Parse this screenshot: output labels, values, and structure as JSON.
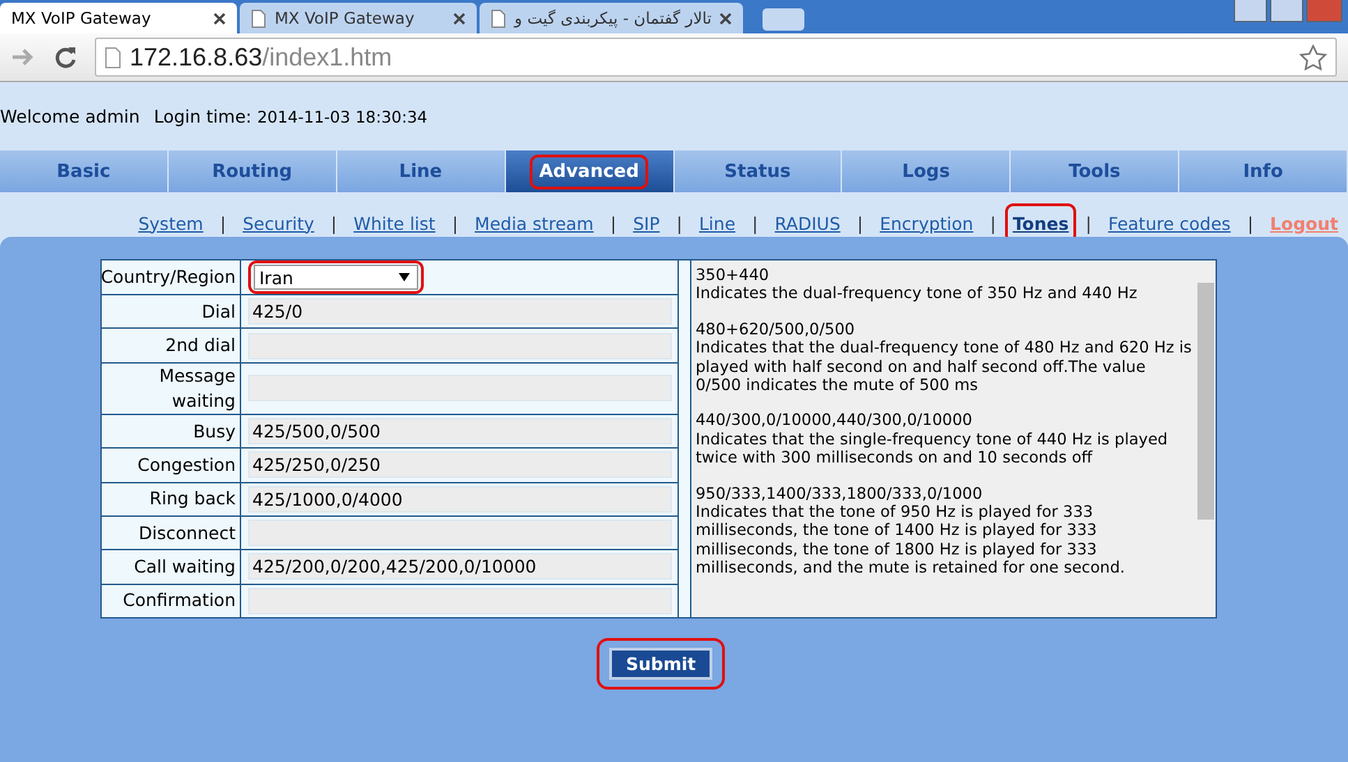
{
  "browser": {
    "tabs": [
      {
        "title": "MX VoIP Gateway",
        "selected": true
      },
      {
        "title": "MX VoIP Gateway",
        "selected": false
      },
      {
        "title": "تالار گفتمان - پیکربندی گیت و",
        "selected": false
      }
    ],
    "address": {
      "host": "172.16.8.63",
      "path": "/index1.htm"
    }
  },
  "header": {
    "welcome": "Welcome admin",
    "login_label": "Login time:",
    "login_time": "2014-11-03 18:30:34"
  },
  "main_tabs": [
    {
      "label": "Basic",
      "selected": false,
      "annotated": false
    },
    {
      "label": "Routing",
      "selected": false,
      "annotated": false
    },
    {
      "label": "Line",
      "selected": false,
      "annotated": false
    },
    {
      "label": "Advanced",
      "selected": true,
      "annotated": true
    },
    {
      "label": "Status",
      "selected": false,
      "annotated": false
    },
    {
      "label": "Logs",
      "selected": false,
      "annotated": false
    },
    {
      "label": "Tools",
      "selected": false,
      "annotated": false
    },
    {
      "label": "Info",
      "selected": false,
      "annotated": false
    }
  ],
  "sub_nav_separator": "|",
  "sub_nav": [
    {
      "label": "System",
      "kind": "link",
      "selected": false,
      "annotated": false
    },
    {
      "label": "Security",
      "kind": "link",
      "selected": false,
      "annotated": false
    },
    {
      "label": "White list",
      "kind": "link",
      "selected": false,
      "annotated": false
    },
    {
      "label": "Media stream",
      "kind": "link",
      "selected": false,
      "annotated": false
    },
    {
      "label": "SIP",
      "kind": "link",
      "selected": false,
      "annotated": false
    },
    {
      "label": "Line",
      "kind": "link",
      "selected": false,
      "annotated": false
    },
    {
      "label": "RADIUS",
      "kind": "link",
      "selected": false,
      "annotated": false
    },
    {
      "label": "Encryption",
      "kind": "link",
      "selected": false,
      "annotated": false
    },
    {
      "label": "Tones",
      "kind": "link",
      "selected": true,
      "annotated": true
    },
    {
      "label": "Feature codes",
      "kind": "link",
      "selected": false,
      "annotated": false
    },
    {
      "label": "Logout",
      "kind": "logout",
      "selected": false,
      "annotated": false
    }
  ],
  "form": {
    "country": {
      "label": "Country/Region",
      "value": "Iran",
      "annotated": true
    },
    "rows": [
      {
        "label": "Dial",
        "value": "425/0"
      },
      {
        "label": "2nd dial",
        "value": ""
      },
      {
        "label": "Message waiting",
        "value": ""
      },
      {
        "label": "Busy",
        "value": "425/500,0/500"
      },
      {
        "label": "Congestion",
        "value": "425/250,0/250"
      },
      {
        "label": "Ring back",
        "value": "425/1000,0/4000"
      },
      {
        "label": "Disconnect",
        "value": ""
      },
      {
        "label": "Call waiting",
        "value": "425/200,0/200,425/200,0/10000"
      },
      {
        "label": "Confirmation",
        "value": ""
      }
    ],
    "help": [
      {
        "code": "350+440",
        "text": "Indicates the dual-frequency tone of 350 Hz and 440 Hz"
      },
      {
        "code": "480+620/500,0/500",
        "text": "Indicates that the dual-frequency tone of 480 Hz and 620 Hz is played with half second on and half second off.The value 0/500 indicates the mute of 500 ms"
      },
      {
        "code": "440/300,0/10000,440/300,0/10000",
        "text": "Indicates that the single-frequency tone of 440 Hz is played twice with 300 milliseconds on and 10 seconds off"
      },
      {
        "code": "950/333,1400/333,1800/333,0/1000",
        "text": "Indicates that the tone of 950 Hz is played for 333 milliseconds, the tone of 1400 Hz is played for 333 milliseconds, the tone of 1800 Hz is played for 333 milliseconds, and the mute is retained for one second."
      }
    ]
  },
  "submit": {
    "label": "Submit",
    "annotated": true
  }
}
